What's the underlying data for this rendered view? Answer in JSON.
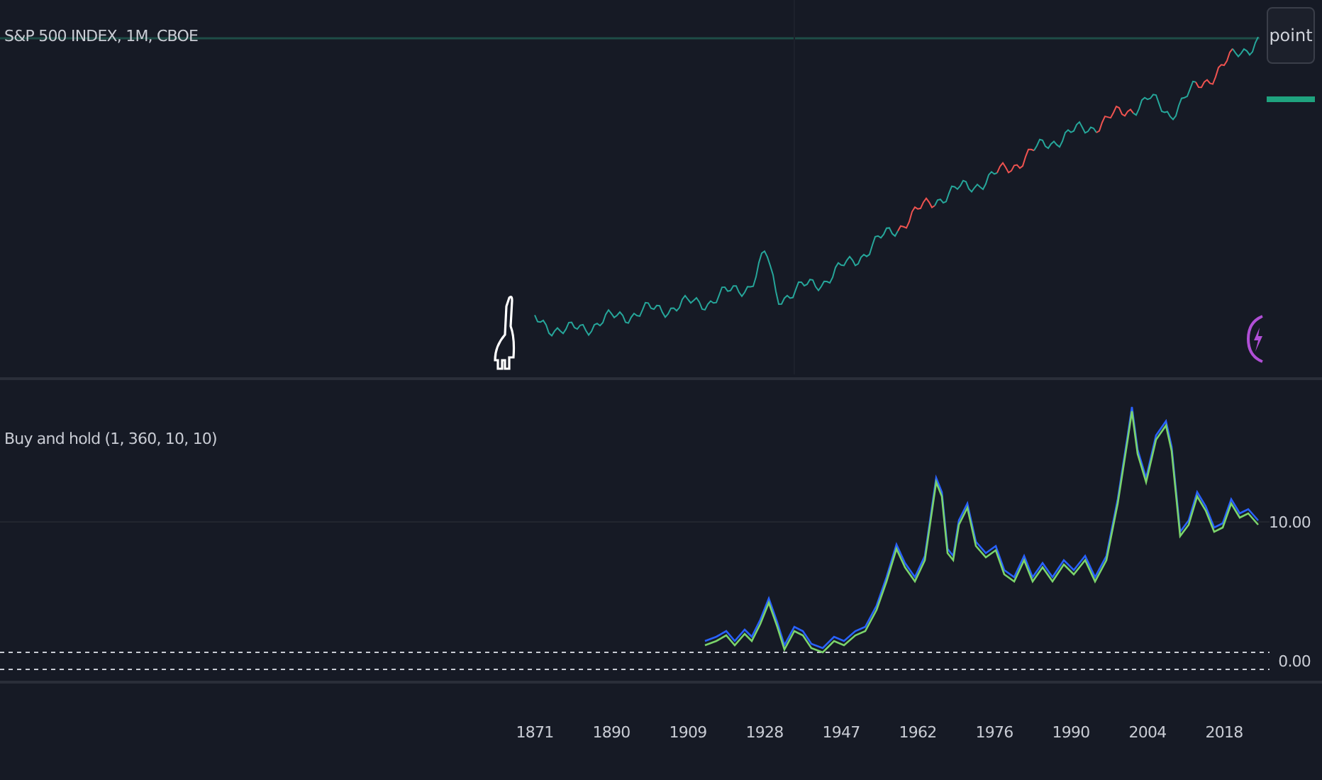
{
  "legend": {
    "symbol": "S&P 500 INDEX, 1M, CBOE"
  },
  "scale_button": {
    "label": "point"
  },
  "indicator": {
    "title": "Buy and hold (1, 360, 10, 10)",
    "axis_labels": [
      "10.00",
      "0.00"
    ]
  },
  "time_axis": [
    "1871",
    "1890",
    "1909",
    "1928",
    "1947",
    "1962",
    "1976",
    "1990",
    "2004",
    "2018"
  ]
}
